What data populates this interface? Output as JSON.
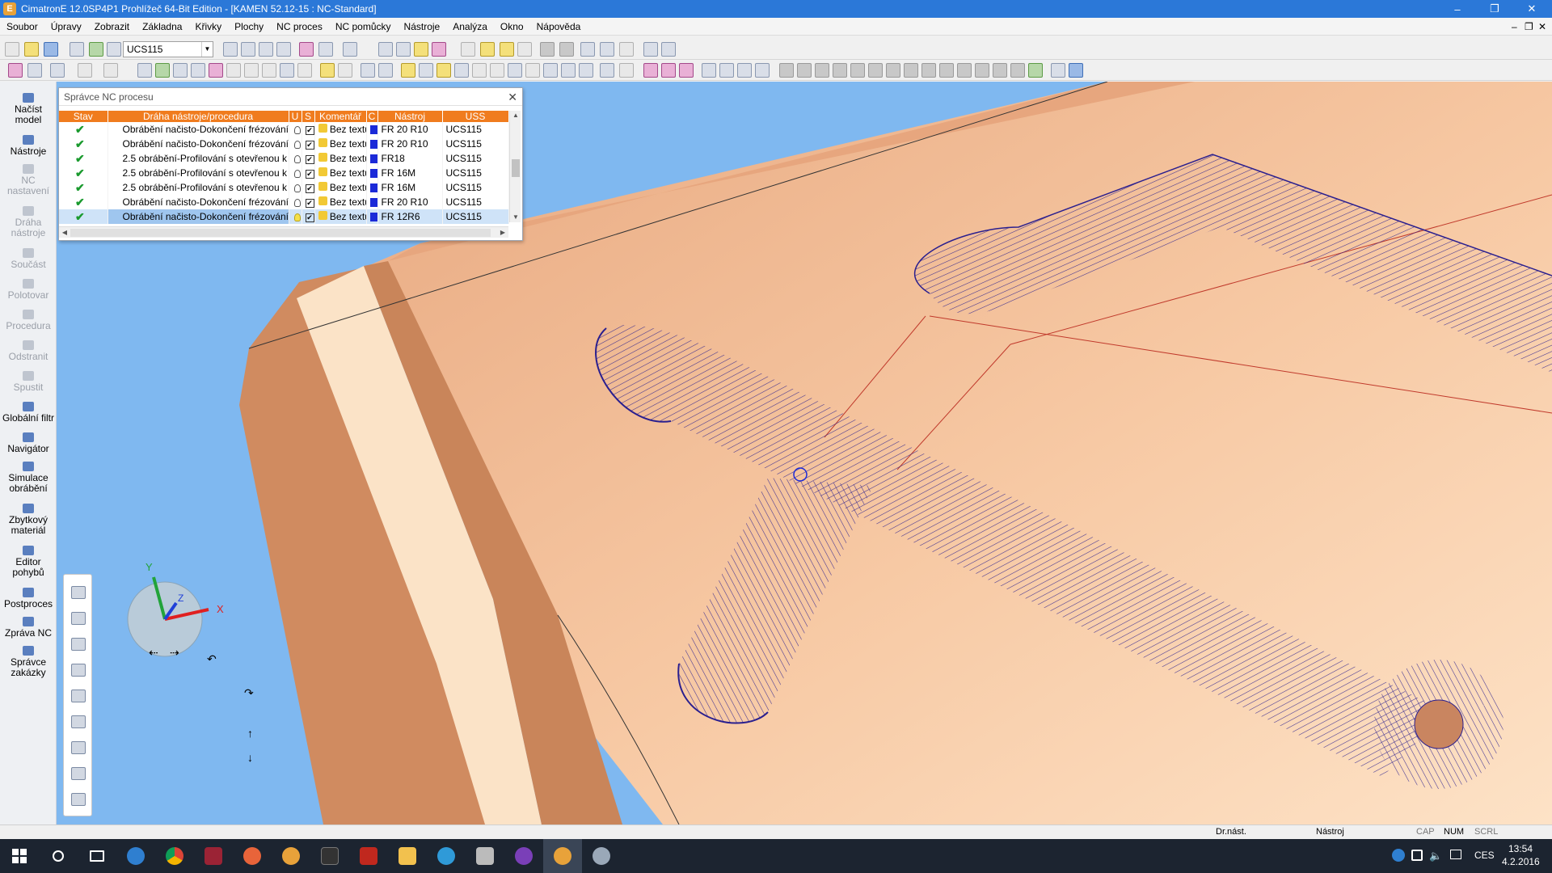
{
  "app": {
    "title": "CimatronE 12.0SP4P1  Prohlížeč 64-Bit Edition - [KAMEN 52.12-15 : NC-Standard]",
    "icon_letter": "E"
  },
  "window_controls": {
    "minimize": "–",
    "restore": "❐",
    "close": "✕"
  },
  "mdi_controls": {
    "minimize": "–",
    "restore": "❐",
    "close": "✕"
  },
  "menu": [
    "Soubor",
    "Úpravy",
    "Zobrazit",
    "Základna",
    "Křivky",
    "Plochy",
    "NC proces",
    "NC pomůcky",
    "Nástroje",
    "Analýza",
    "Okno",
    "Nápověda"
  ],
  "toolbar": {
    "ucs_value": "UCS115"
  },
  "left_panel": {
    "items": [
      {
        "label": "Načíst model",
        "enabled": true
      },
      {
        "label": "Nástroje",
        "enabled": true
      },
      {
        "label": "NC nastavení",
        "enabled": false
      },
      {
        "label": "Dráha nástroje",
        "enabled": false
      },
      {
        "label": "Součást",
        "enabled": false
      },
      {
        "label": "Polotovar",
        "enabled": false
      },
      {
        "label": "Procedura",
        "enabled": false
      },
      {
        "label": "Odstranit",
        "enabled": false
      },
      {
        "label": "Spustit",
        "enabled": false
      },
      {
        "label": "Globální filtr",
        "enabled": true
      },
      {
        "label": "Navigátor",
        "enabled": true
      },
      {
        "label": "Simulace obrábění",
        "enabled": true
      },
      {
        "label": "Zbytkový materiál",
        "enabled": true
      },
      {
        "label": "Editor pohybů",
        "enabled": true
      },
      {
        "label": "Postproces",
        "enabled": true
      },
      {
        "label": "Zpráva NC",
        "enabled": true
      },
      {
        "label": "Správce zakázky",
        "enabled": true
      }
    ]
  },
  "nc_manager": {
    "title": "Správce NC procesu",
    "close": "✕",
    "columns": [
      "Stav",
      "Dráha nástroje/procedura",
      "U",
      "S",
      "Komentář",
      "C",
      "Nástroj",
      "USS"
    ],
    "rows": [
      {
        "status": "✔",
        "procedure": "Obrábění načisto-Dokončení frézování",
        "u": "✔",
        "comment": "Bez textu",
        "tool": "FR 20 R10",
        "uss": "UCS115",
        "selected": false
      },
      {
        "status": "✔",
        "procedure": "Obrábění načisto-Dokončení frézování",
        "u": "✔",
        "comment": "Bez textu",
        "tool": "FR 20 R10",
        "uss": "UCS115",
        "selected": false
      },
      {
        "status": "✔",
        "procedure": "2.5 obrábění-Profilování s otevřenou k",
        "u": "✔",
        "comment": "Bez textu",
        "tool": "FR18",
        "uss": "UCS115",
        "selected": false
      },
      {
        "status": "✔",
        "procedure": "2.5 obrábění-Profilování s otevřenou k",
        "u": "✔",
        "comment": "Bez textu",
        "tool": "FR 16M",
        "uss": "UCS115",
        "selected": false
      },
      {
        "status": "✔",
        "procedure": "2.5 obrábění-Profilování s otevřenou k",
        "u": "✔",
        "comment": "Bez textu",
        "tool": "FR 16M",
        "uss": "UCS115",
        "selected": false
      },
      {
        "status": "✔",
        "procedure": "Obrábění načisto-Dokončení frézování",
        "u": "✔",
        "comment": "Bez textu",
        "tool": "FR 20 R10",
        "uss": "UCS115",
        "selected": false
      },
      {
        "status": "✔",
        "procedure": "Obrábění načisto-Dokončení frézování",
        "u": "✔",
        "comment": "Bez textu",
        "tool": "FR 12R6",
        "uss": "UCS115",
        "selected": true
      }
    ],
    "tool_color": "#1b2ad8"
  },
  "triad": {
    "x": "X",
    "y": "Y",
    "z": "Z"
  },
  "view_arrows": [
    "⇠",
    "⇢",
    "↶",
    "↷",
    "↑",
    "↓"
  ],
  "statusbar": {
    "dr_nast": "Dr.nást.",
    "nastroj": "Nástroj",
    "cap": "CAP",
    "num": "NUM",
    "scrl": "SCRL"
  },
  "taskbar": {
    "time": "13:54",
    "date": "4.2.2016",
    "lang": "CES"
  },
  "colors": {
    "part_face": "#f7c9a4",
    "part_face_light": "#fce0c4",
    "part_side": "#d08b60",
    "background": "#7fb8f0",
    "toolpath": "#2a1f8f",
    "header_orange": "#f07c1e",
    "titlebar": "#2b78d8"
  }
}
